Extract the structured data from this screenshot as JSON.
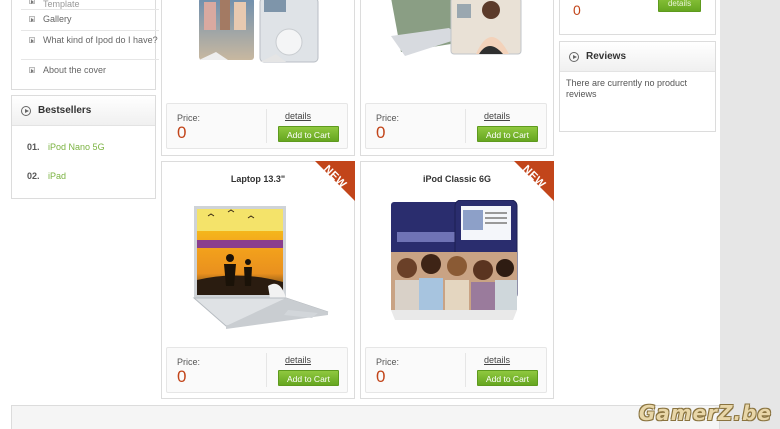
{
  "sidebar": {
    "menu": [
      {
        "label": "Template"
      },
      {
        "label": "Gallery"
      },
      {
        "label": "What kind of Ipod do I have?"
      },
      {
        "label": "About the cover"
      }
    ],
    "bestsellers": {
      "title": "Bestsellers",
      "items": [
        {
          "rank": "01.",
          "name": "iPod Nano 5G"
        },
        {
          "rank": "02.",
          "name": "iPad"
        }
      ]
    }
  },
  "products": [
    {
      "name": "",
      "price_label": "Price:",
      "price": "0",
      "details": "details",
      "cart": "Add to Cart",
      "is_new": false
    },
    {
      "name": "",
      "price_label": "Price:",
      "price": "0",
      "details": "details",
      "cart": "Add to Cart",
      "is_new": false
    },
    {
      "name": "Laptop 13.3\"",
      "price_label": "Price:",
      "price": "0",
      "details": "details",
      "cart": "Add to Cart",
      "is_new": true,
      "badge": "NEW"
    },
    {
      "name": "iPod Classic 6G",
      "price_label": "Price:",
      "price": "0",
      "details": "details",
      "cart": "Add to Cart",
      "is_new": true,
      "badge": "NEW"
    }
  ],
  "right_top": {
    "price": "0",
    "details": "details"
  },
  "reviews": {
    "title": "Reviews",
    "text": "There are currently no product reviews"
  },
  "watermark": "GamerZ.be",
  "colors": {
    "accent_green": "#7bb341",
    "price_orange": "#c2451a",
    "button_green": "#76b32c"
  }
}
